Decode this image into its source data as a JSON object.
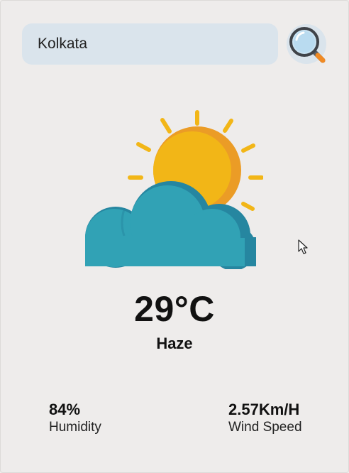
{
  "search": {
    "value": "Kolkata",
    "button_icon": "search-icon"
  },
  "weather": {
    "icon": "sun-behind-cloud-icon",
    "temperature": "29°C",
    "condition": "Haze"
  },
  "stats": {
    "humidity": {
      "value": "84%",
      "label": "Humidity",
      "icon": ""
    },
    "wind": {
      "value": "2.57Km/H",
      "label": "Wind Speed",
      "icon": ""
    }
  },
  "colors": {
    "background": "#eeeceb",
    "input_bg": "#dae4ec",
    "sun": "#f2b617",
    "sun_shadow": "#eb9c26",
    "cloud": "#31a2b5",
    "cloud_shadow": "#2686a0"
  }
}
